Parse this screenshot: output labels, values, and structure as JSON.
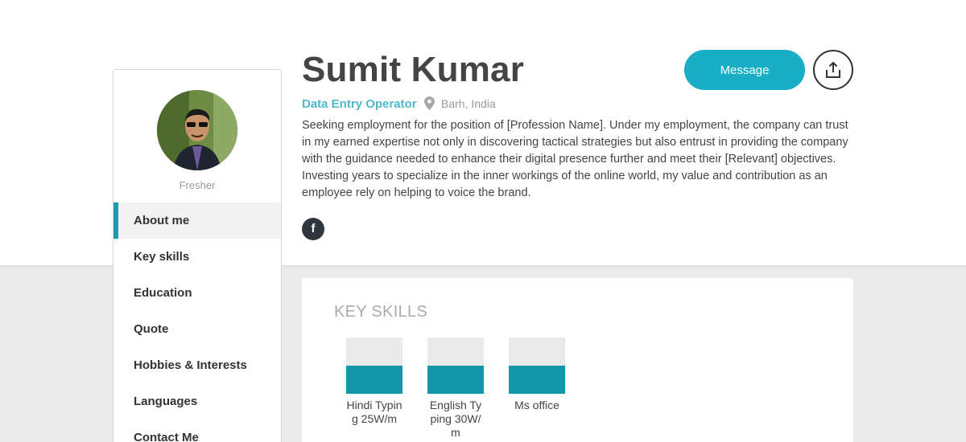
{
  "profile": {
    "name": "Sumit Kumar",
    "title": "Data Entry Operator",
    "location": "Barh, India",
    "status": "Fresher",
    "bio": "Seeking employment for the position of [Profession Name]. Under my employment, the company can trust in my earned expertise not only in discovering tactical strategies but also entrust in providing the company with the guidance needed to enhance their digital presence further and meet their [Relevant] objectives. Investing years to specialize in the inner workings of the online world, my value and contribution as an employee rely on helping to voice the brand."
  },
  "actions": {
    "message_label": "Message",
    "share_icon": "share-icon",
    "facebook_icon_text": "f"
  },
  "nav": {
    "items": [
      {
        "label": "About me",
        "active": true
      },
      {
        "label": "Key skills"
      },
      {
        "label": "Education"
      },
      {
        "label": "Quote"
      },
      {
        "label": "Hobbies & Interests"
      },
      {
        "label": "Languages"
      },
      {
        "label": "Contact Me"
      }
    ]
  },
  "skills": {
    "heading": "KEY SKILLS",
    "items": [
      {
        "label": "Hindi Typing 25W/m",
        "level": 0.5
      },
      {
        "label": "English Typing 30W/m",
        "level": 0.5
      },
      {
        "label": "Ms office",
        "level": 0.5
      }
    ]
  },
  "colors": {
    "accent": "#18aec6",
    "skill_fill": "#1296aa",
    "title": "#4fb8c9"
  }
}
